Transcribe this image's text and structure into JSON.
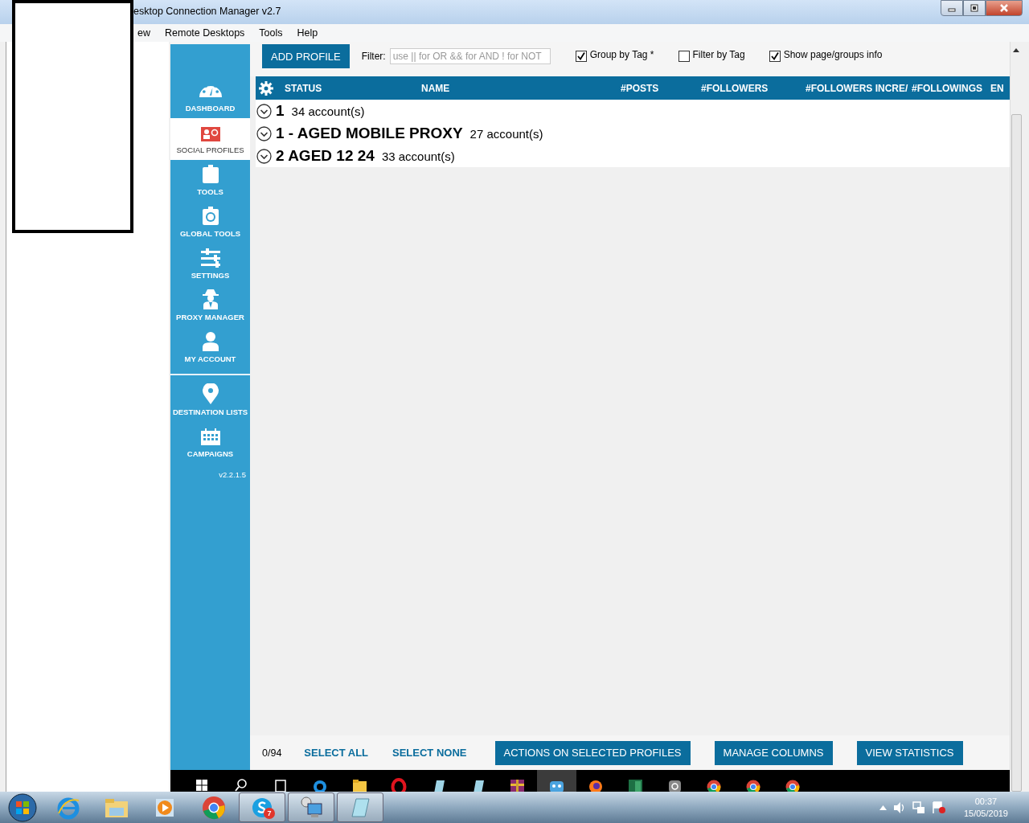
{
  "window": {
    "title": "esktop Connection Manager v2.7"
  },
  "menu": [
    {
      "label": "ew"
    },
    {
      "label": "Remote Desktops"
    },
    {
      "label": "Tools"
    },
    {
      "label": "Help"
    }
  ],
  "sidebar": {
    "sections": [
      {
        "items": [
          {
            "label": "DASHBOARD",
            "selected": false
          },
          {
            "label": "SOCIAL PROFILES",
            "selected": true
          },
          {
            "label": "TOOLS",
            "selected": false
          },
          {
            "label": "GLOBAL TOOLS",
            "selected": false
          },
          {
            "label": "SETTINGS",
            "selected": false
          },
          {
            "label": "PROXY MANAGER",
            "selected": false
          },
          {
            "label": "MY ACCOUNT",
            "selected": false
          }
        ]
      },
      {
        "items": [
          {
            "label": "DESTINATION LISTS",
            "selected": false
          },
          {
            "label": "CAMPAIGNS",
            "selected": false
          }
        ]
      }
    ],
    "version": "v2.2.1.5"
  },
  "toolbar": {
    "add_button": "ADD PROFILE",
    "filter": {
      "label": "Filter:",
      "placeholder": "use || for OR && for AND ! for NOT"
    },
    "checkboxes": [
      {
        "label": "Group by Tag *",
        "checked": true
      },
      {
        "label": "Filter by Tag",
        "checked": false
      },
      {
        "label": "Show page/groups info",
        "checked": true
      }
    ]
  },
  "table": {
    "columns": [
      "STATUS",
      "NAME",
      "#POSTS",
      "#FOLLOWERS",
      "#FOLLOWERS INCRE/",
      "#FOLLOWINGS",
      "EN"
    ],
    "groups": [
      {
        "name": "1",
        "count": "34 account(s)"
      },
      {
        "name": "1 - AGED MOBILE PROXY",
        "count": "27 account(s)"
      },
      {
        "name": "2 AGED 12 24",
        "count": "33 account(s)"
      }
    ]
  },
  "footer": {
    "selection": "0/94",
    "links": [
      "SELECT ALL",
      "SELECT NONE"
    ],
    "buttons": [
      "ACTIONS ON SELECTED PROFILES",
      "MANAGE COLUMNS",
      "VIEW STATISTICS"
    ]
  },
  "taskbar": {
    "skype_badge": "7",
    "time": "00:37",
    "date": "15/05/2019"
  }
}
